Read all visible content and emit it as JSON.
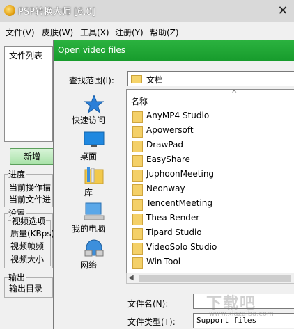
{
  "main": {
    "title": "PSP转换大师 [6.0]",
    "close_glyph": "✕",
    "menu": [
      "文件(V)",
      "皮肤(W)",
      "工具(X)",
      "注册(Y)",
      "帮助(Z)"
    ],
    "file_list_label": "文件列表",
    "add_button": "新增",
    "progress": {
      "label": "进度",
      "rows": [
        "当前操作描",
        "当前文件进"
      ]
    },
    "settings": {
      "label": "设置",
      "video_label": "视频选项",
      "rows": [
        "质量(KBps)",
        "视频帧频",
        "视频大小"
      ]
    },
    "output": {
      "label": "输出",
      "rows": [
        "输出目录"
      ]
    }
  },
  "dialog": {
    "title": "Open video files",
    "look_in_label": "查找范围(I):",
    "look_in_value": "文档",
    "places": [
      {
        "label": "快速访问",
        "icon": "star-icon"
      },
      {
        "label": "桌面",
        "icon": "desktop-icon"
      },
      {
        "label": "库",
        "icon": "library-icon"
      },
      {
        "label": "我的电脑",
        "icon": "computer-icon"
      },
      {
        "label": "网络",
        "icon": "network-icon"
      }
    ],
    "column_name": "名称",
    "items": [
      "AnyMP4 Studio",
      "Apowersoft",
      "DrawPad",
      "EasyShare",
      "JuphoonMeeting",
      "Neonway",
      "TencentMeeting",
      "Thea Render",
      "Tipard Studio",
      "VideoSolo Studio",
      "Win-Tool"
    ],
    "filename_label": "文件名(N):",
    "filename_value": "",
    "filetype_label": "文件类型(T):",
    "filetype_value": "Support files"
  },
  "watermark": {
    "text": "下载吧",
    "url": "www.xiazaiba.com"
  },
  "colors": {
    "dialog_title": "#1fa834",
    "add_button": "#a9e2a9"
  }
}
